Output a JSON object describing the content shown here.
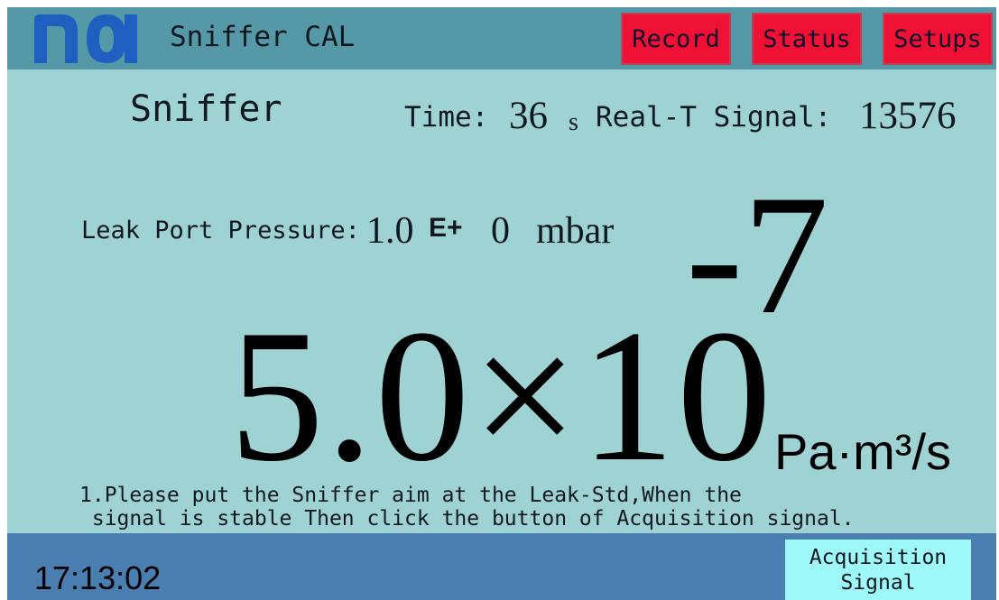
{
  "header": {
    "logo_text": "nci",
    "title": "Sniffer CAL",
    "buttons": {
      "record": "Record",
      "status": "Status",
      "setups": "Setups"
    }
  },
  "main": {
    "mode": "Sniffer",
    "time_label": "Time:",
    "time_value": "36",
    "time_unit": "s",
    "signal_label": "Real-T Signal:",
    "signal_value": "13576",
    "pressure_label": "Leak Port Pressure:",
    "pressure_mantissa": "1.0",
    "pressure_e": "E+",
    "pressure_exponent": "0",
    "pressure_unit": "mbar",
    "leak_rate_value": "5.0×10",
    "leak_rate_exponent": "-7",
    "leak_rate_unit": "Pa·m³/s",
    "instruction_line1": "1.Please put the Sniffer aim at the Leak-Std,When the",
    "instruction_line2": " signal is stable Then click the button of Acquisition signal."
  },
  "footer": {
    "clock": "17:13:02",
    "acquisition_line1": "Acquisition",
    "acquisition_line2": "Signal"
  },
  "colors": {
    "background": "#9fd3d3",
    "header": "#5599a8",
    "footer": "#4b7eb0",
    "nav_button": "#ee1133",
    "acquisition_button": "#9ff8f8",
    "logo": "#1e5fbf"
  }
}
